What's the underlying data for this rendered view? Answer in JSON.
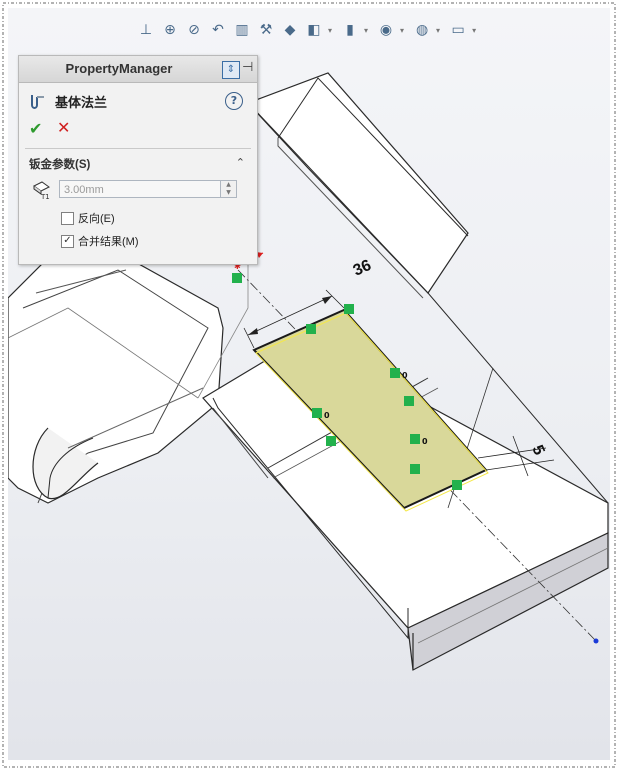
{
  "toolbar": {
    "items": [
      {
        "name": "view-orientation-icon"
      },
      {
        "name": "zoom-to-fit-icon"
      },
      {
        "name": "zoom-to-area-icon"
      },
      {
        "name": "previous-view-icon"
      },
      {
        "name": "section-view-icon"
      },
      {
        "name": "dynamic-annotation-icon"
      },
      {
        "name": "view-cube-icon"
      },
      {
        "name": "display-style-icon"
      },
      {
        "name": "hide-show-icon"
      },
      {
        "name": "edit-appearance-icon"
      },
      {
        "name": "apply-scene-icon"
      },
      {
        "name": "view-settings-icon"
      }
    ]
  },
  "property_manager": {
    "title": "PropertyManager",
    "feature_title": "基体法兰",
    "help_symbol": "?",
    "ok_symbol": "✔",
    "cancel_symbol": "✕",
    "group_title": "钣金参数(S)",
    "collapse_symbol": "⌃",
    "thickness_value": "3.00mm",
    "thickness_icon_label": "T1",
    "checkboxes": [
      {
        "label": "反向(E)",
        "checked": false
      },
      {
        "label": "合并结果(M)",
        "checked": true
      }
    ]
  },
  "sketch": {
    "dimension_length": "36",
    "dimension_offset": "5",
    "relation_zero": "0"
  },
  "colors": {
    "sketch_fill": "#d9d89a",
    "sketch_outline": "#1a1a1a",
    "relation_green": "#22b14c",
    "part_face": "#ffffff",
    "part_edge": "#2a2a2a"
  }
}
